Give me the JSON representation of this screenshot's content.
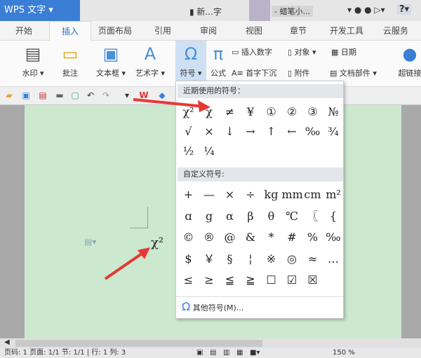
{
  "titlebar": {
    "app": "WPS 文字",
    "doc": "新...字",
    "user": "- 蜡笔小...",
    "help": "?"
  },
  "tabs": [
    "开始",
    "插入",
    "页面布局",
    "引用",
    "审阅",
    "视图",
    "章节",
    "开发工具",
    "云服务"
  ],
  "ribbon": {
    "watermark": "水印",
    "comment": "批注",
    "textbox": "文本框",
    "wordart": "艺术字",
    "symbol": "符号",
    "formula": "公式",
    "insert_number": "插入数字",
    "object": "对象",
    "date": "日期",
    "dropcap": "首字下沉",
    "attachment": "附件",
    "docparts": "文档部件",
    "hyperlink": "超链接"
  },
  "menu": {
    "recent_header": "近期使用的符号：",
    "recent": [
      "χ²",
      "χ",
      "≠",
      "¥",
      "①",
      "②",
      "③",
      "№",
      "√",
      "×",
      "↓",
      "→",
      "↑",
      "←",
      "‰",
      "¾",
      "½",
      "¼"
    ],
    "custom_header": "自定义符号:",
    "custom": [
      "+",
      "—",
      "×",
      "÷",
      "kg",
      "mm",
      "cm",
      "m²",
      "ɑ",
      "g",
      "α",
      "β",
      "θ",
      "℃",
      "〖",
      "{",
      "©",
      "®",
      "@",
      "&",
      "*",
      "#",
      "%",
      "‰",
      "$",
      "￥",
      "§",
      "¦",
      "※",
      "◎",
      "≈",
      "…",
      "≤",
      "≥",
      "≦",
      "≧",
      "☐",
      "☑",
      "☒"
    ],
    "more": "其他符号(M)..."
  },
  "document": {
    "text": "χ²"
  },
  "status": {
    "text": "页码: 1  页面: 1/1  节: 1/1 | 行: 1  列: 3",
    "zoom": "150 %"
  },
  "colors": {
    "accent": "#3a7fd5",
    "page": "#cce8cf",
    "arrow": "#e53935"
  }
}
